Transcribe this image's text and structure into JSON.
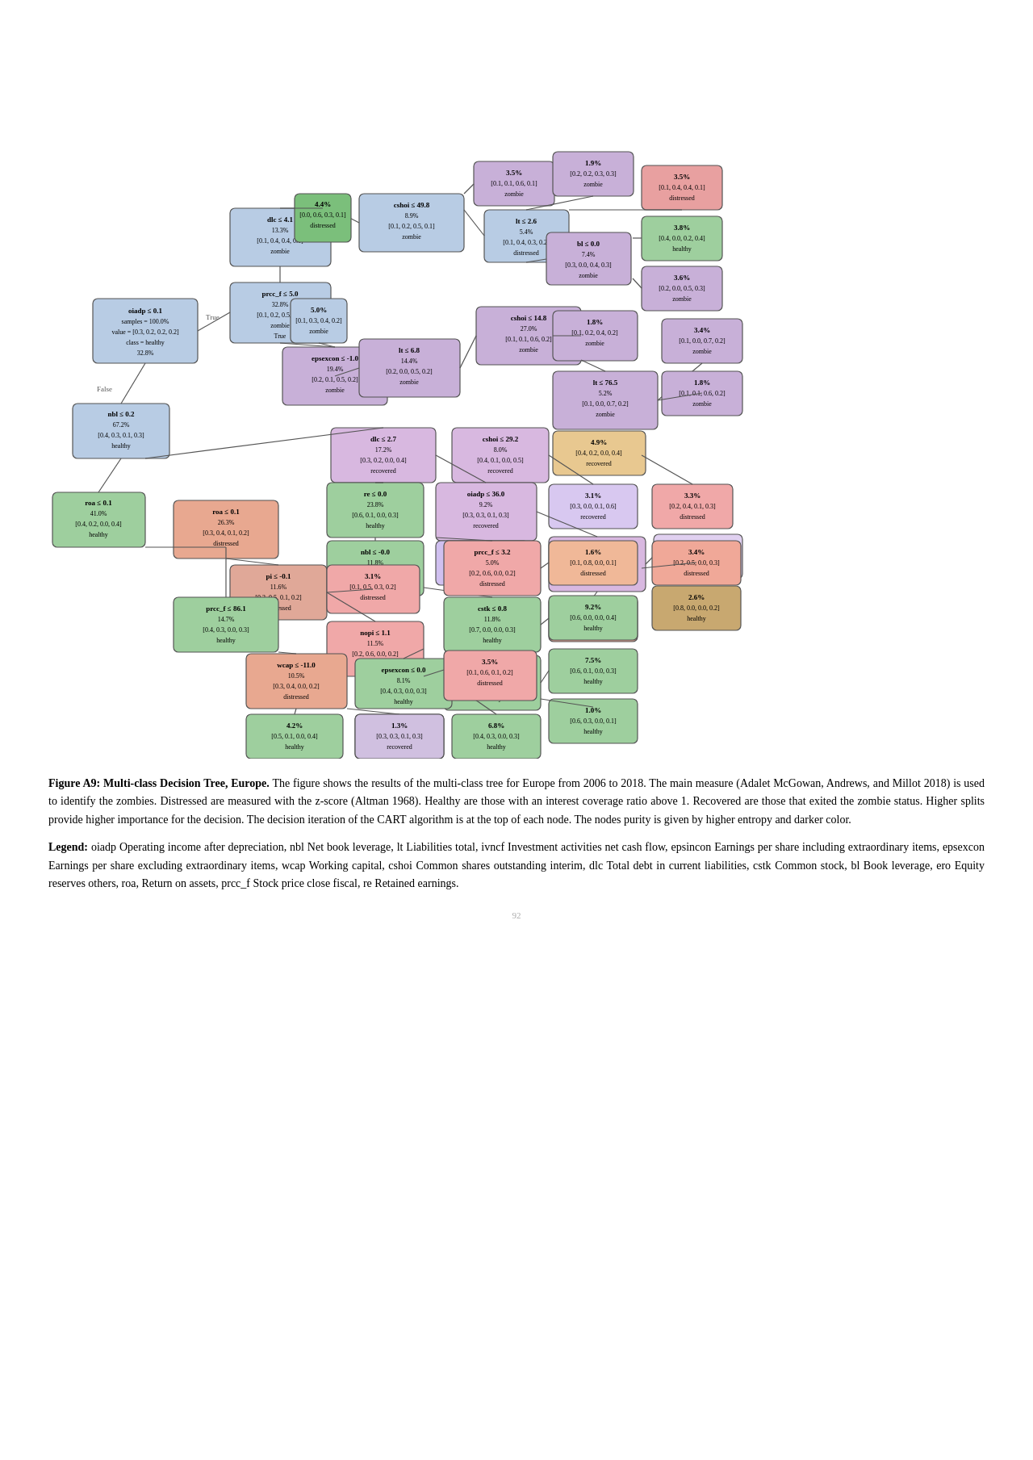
{
  "figure": {
    "title": "Figure A9:  Multi-class Decision Tree, Europe.",
    "description": " The figure shows the results of the multi-class tree for Europe from 2006 to 2018. The main measure (Adalet McGowan, Andrews, and Millot 2018) is used to identify the zombies. Distressed are measured with the z-score (Altman 1968). Healthy are those with an interest coverage ratio above 1. Recovered are those that exited the zombie status. Higher splits provide higher importance for the decision. The decision iteration of the CART algorithm is at the top of each node. The nodes purity is given by higher entropy and darker color.",
    "legend_title": "Legend: ",
    "legend_text": "oiadp Operating income after depreciation, nbl Net book leverage, lt Liabilities total, ivncf Investment activities net cash flow, epsincon Earnings per share including extraordinary items, epsexcon Earnings per share excluding extraordinary items, wcap Working capital, cshoi Common shares outstanding interim, dlc Total debt in current liabilities, cstk Common stock, bl Book leverage, ero Equity reserves others, roa, Return on assets, prcc_f Stock price close fiscal, re Retained earnings.",
    "page_number": "92"
  }
}
